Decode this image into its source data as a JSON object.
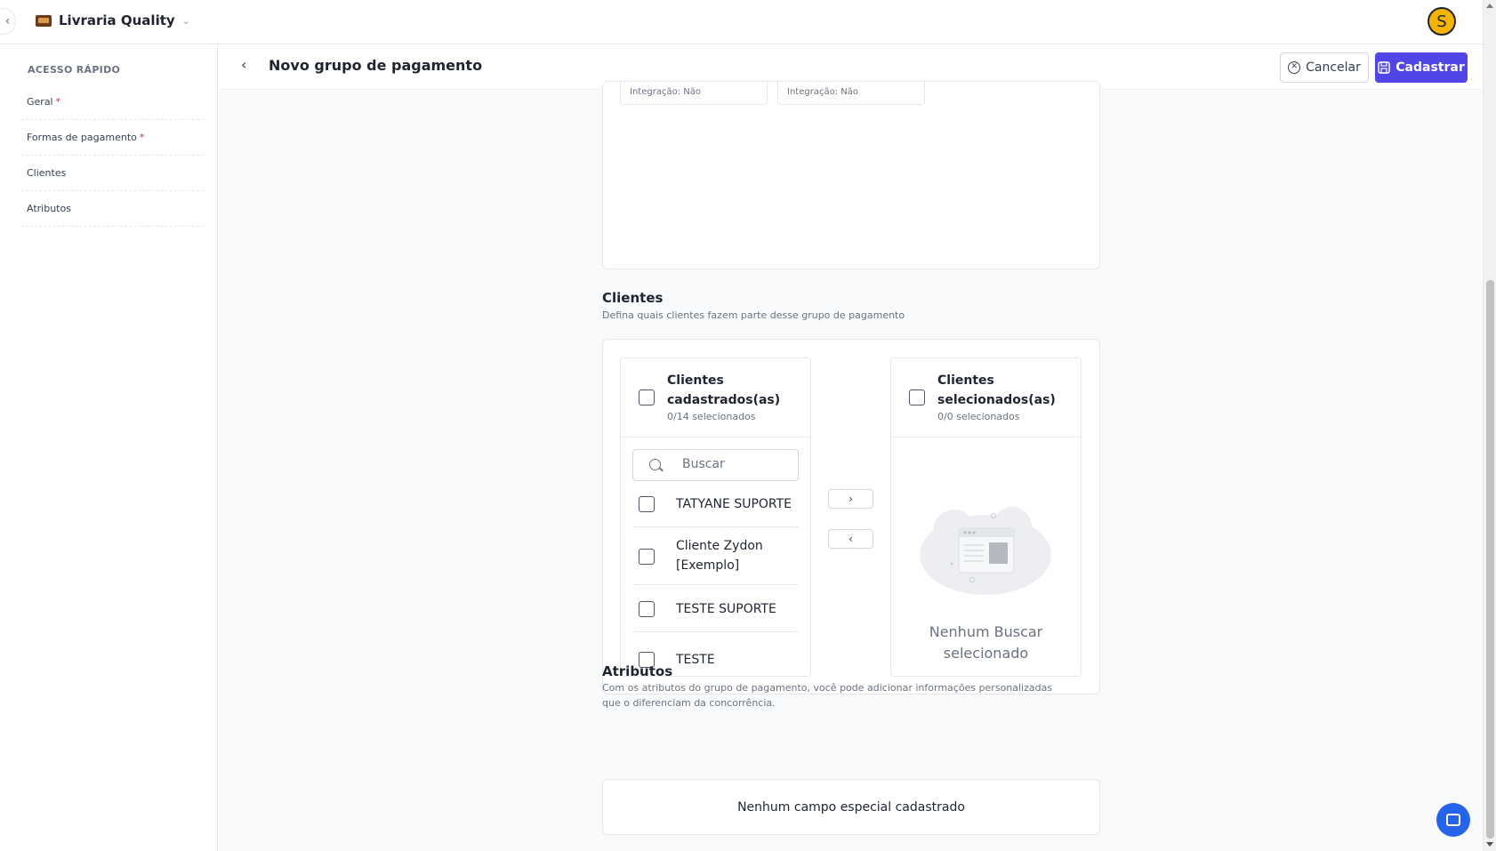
{
  "topbar": {
    "collapse_icon": "‹",
    "brand_name": "Livraria Quality",
    "switch_icon": "⌄",
    "avatar_letter": "S"
  },
  "sidebar": {
    "title": "ACESSO RÁPIDO",
    "items": [
      {
        "label": "Geral",
        "required": "*"
      },
      {
        "label": "Formas de pagamento",
        "required": "*"
      },
      {
        "label": "Clientes",
        "required": ""
      },
      {
        "label": "Atributos",
        "required": ""
      }
    ]
  },
  "header": {
    "back_icon": "‹",
    "title": "Novo grupo de pagamento",
    "cancel_label": "Cancelar",
    "submit_label": "Cadastrar"
  },
  "payments": {
    "tiles": [
      {
        "integration": "Integração: Não"
      },
      {
        "integration": "Integração: Não"
      }
    ]
  },
  "clients": {
    "title": "Clientes",
    "subtitle": "Defina quais clientes fazem parte desse grupo de pagamento",
    "source": {
      "title": "Clientes cadastrados(as)",
      "count": "0/14 selecionados",
      "search_placeholder": "Buscar",
      "items": [
        {
          "label": "TATYANE SUPORTE"
        },
        {
          "label": "Cliente Zydon [Exemplo]"
        },
        {
          "label": "TESTE SUPORTE"
        },
        {
          "label": "TESTE"
        }
      ]
    },
    "move_right": "›",
    "move_left": "‹",
    "target": {
      "title": "Clientes selecionados(as)",
      "count": "0/0 selecionados",
      "empty_text": "Nenhum Buscar selecionado"
    }
  },
  "attributes": {
    "title": "Atributos",
    "subtitle": "Com os atributos do grupo de pagamento, você pode adicionar informações personalizadas que o diferenciam da concorrência.",
    "empty_text": "Nenhum campo especial cadastrado"
  },
  "colors": {
    "primary": "#4f46e5",
    "avatar": "#f5b400",
    "required": "#e11d48",
    "chat": "#2563eb"
  },
  "icons": {
    "brand": "book-logo-icon",
    "cancel": "circle-x-icon",
    "submit": "save-icon",
    "search": "search-icon",
    "chat": "chat-icon"
  }
}
